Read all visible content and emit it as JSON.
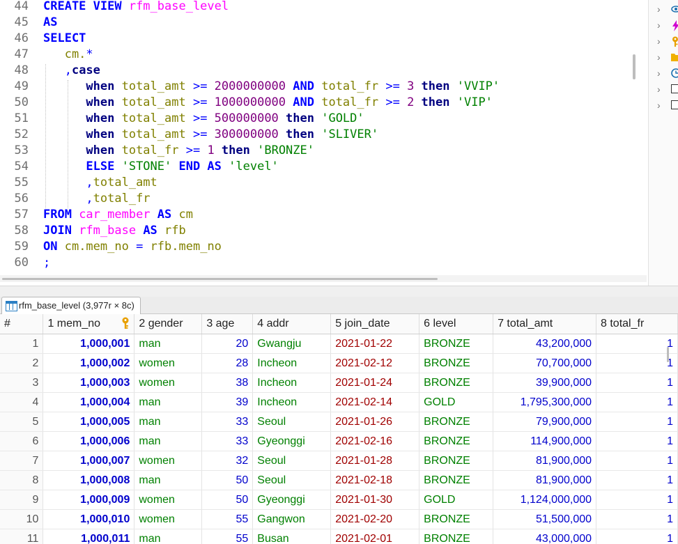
{
  "editor": {
    "line_numbers": [
      "44",
      "45",
      "46",
      "47",
      "48",
      "49",
      "50",
      "51",
      "52",
      "53",
      "54",
      "55",
      "56",
      "57",
      "58",
      "59",
      "60"
    ],
    "lines": [
      [
        {
          "t": "CREATE VIEW ",
          "c": "kw"
        },
        {
          "t": "rfm_base_level",
          "c": "tbl"
        }
      ],
      [
        {
          "t": "AS",
          "c": "kw"
        }
      ],
      [
        {
          "t": "SELECT",
          "c": "kw"
        }
      ],
      [
        {
          "t": "   cm.",
          "c": "id"
        },
        {
          "t": "*",
          "c": "op"
        }
      ],
      [
        {
          "t": "   ,",
          "c": "op"
        },
        {
          "t": "case",
          "c": "kwd"
        }
      ],
      [
        {
          "t": "      when ",
          "c": "kwd"
        },
        {
          "t": "total_amt",
          "c": "id"
        },
        {
          "t": " >= ",
          "c": "op"
        },
        {
          "t": "2000000000",
          "c": "num"
        },
        {
          "t": " AND ",
          "c": "kw"
        },
        {
          "t": "total_fr",
          "c": "id"
        },
        {
          "t": " >= ",
          "c": "op"
        },
        {
          "t": "3",
          "c": "num"
        },
        {
          "t": " then ",
          "c": "kwd"
        },
        {
          "t": "'VVIP'",
          "c": "str"
        }
      ],
      [
        {
          "t": "      when ",
          "c": "kwd"
        },
        {
          "t": "total_amt",
          "c": "id"
        },
        {
          "t": " >= ",
          "c": "op"
        },
        {
          "t": "1000000000",
          "c": "num"
        },
        {
          "t": " AND ",
          "c": "kw"
        },
        {
          "t": "total_fr",
          "c": "id"
        },
        {
          "t": " >= ",
          "c": "op"
        },
        {
          "t": "2",
          "c": "num"
        },
        {
          "t": " then ",
          "c": "kwd"
        },
        {
          "t": "'VIP'",
          "c": "str"
        }
      ],
      [
        {
          "t": "      when ",
          "c": "kwd"
        },
        {
          "t": "total_amt",
          "c": "id"
        },
        {
          "t": " >= ",
          "c": "op"
        },
        {
          "t": "500000000",
          "c": "num"
        },
        {
          "t": " then ",
          "c": "kwd"
        },
        {
          "t": "'GOLD'",
          "c": "str"
        }
      ],
      [
        {
          "t": "      when ",
          "c": "kwd"
        },
        {
          "t": "total_amt",
          "c": "id"
        },
        {
          "t": " >= ",
          "c": "op"
        },
        {
          "t": "300000000",
          "c": "num"
        },
        {
          "t": " then ",
          "c": "kwd"
        },
        {
          "t": "'SLIVER'",
          "c": "str"
        }
      ],
      [
        {
          "t": "      when ",
          "c": "kwd"
        },
        {
          "t": "total_fr",
          "c": "id"
        },
        {
          "t": " >= ",
          "c": "op"
        },
        {
          "t": "1",
          "c": "num"
        },
        {
          "t": " then ",
          "c": "kwd"
        },
        {
          "t": "'BRONZE'",
          "c": "str"
        }
      ],
      [
        {
          "t": "      ELSE ",
          "c": "kw"
        },
        {
          "t": "'STONE'",
          "c": "str"
        },
        {
          "t": " END AS ",
          "c": "kw"
        },
        {
          "t": "'level'",
          "c": "str"
        }
      ],
      [
        {
          "t": "      ,",
          "c": "op"
        },
        {
          "t": "total_amt",
          "c": "id"
        }
      ],
      [
        {
          "t": "      ,",
          "c": "op"
        },
        {
          "t": "total_fr",
          "c": "id"
        }
      ],
      [
        {
          "t": "FROM ",
          "c": "kw"
        },
        {
          "t": "car_member",
          "c": "tbl"
        },
        {
          "t": " AS ",
          "c": "kw"
        },
        {
          "t": "cm",
          "c": "id"
        }
      ],
      [
        {
          "t": "JOIN ",
          "c": "kw"
        },
        {
          "t": "rfm_base",
          "c": "tbl"
        },
        {
          "t": " AS ",
          "c": "kw"
        },
        {
          "t": "rfb",
          "c": "id"
        }
      ],
      [
        {
          "t": "ON ",
          "c": "kw"
        },
        {
          "t": "cm.mem_no",
          "c": "id"
        },
        {
          "t": " = ",
          "c": "op"
        },
        {
          "t": "rfb.mem_no",
          "c": "id"
        }
      ],
      [
        {
          "t": ";",
          "c": "op"
        }
      ]
    ]
  },
  "right_panel": {
    "items": [
      {
        "icon": "eye-icon",
        "color": "#1a6fb0"
      },
      {
        "icon": "lightning-icon",
        "color": "#d000d0"
      },
      {
        "icon": "key-icon",
        "color": "#e8a000"
      },
      {
        "icon": "folder-icon",
        "color": "#f0b000"
      },
      {
        "icon": "clock-icon",
        "color": "#1a6fb0"
      },
      {
        "icon": "checkbox-icon",
        "color": "#333333"
      },
      {
        "icon": "checkbox-icon",
        "color": "#333333"
      }
    ]
  },
  "result_tab": {
    "label": "rfm_base_level (3,977r × 8c)"
  },
  "grid": {
    "row_header": "#",
    "columns": [
      "1 mem_no",
      "2 gender",
      "3 age",
      "4 addr",
      "5 join_date",
      "6 level",
      "7 total_amt",
      "8 total_fr"
    ],
    "rows": [
      {
        "n": "1",
        "mem_no": "1,000,001",
        "gender": "man",
        "age": "20",
        "addr": "Gwangju",
        "join_date": "2021-01-22",
        "level": "BRONZE",
        "total_amt": "43,200,000",
        "total_fr": "1"
      },
      {
        "n": "2",
        "mem_no": "1,000,002",
        "gender": "women",
        "age": "28",
        "addr": "Incheon",
        "join_date": "2021-02-12",
        "level": "BRONZE",
        "total_amt": "70,700,000",
        "total_fr": "1"
      },
      {
        "n": "3",
        "mem_no": "1,000,003",
        "gender": "women",
        "age": "38",
        "addr": "Incheon",
        "join_date": "2021-01-24",
        "level": "BRONZE",
        "total_amt": "39,900,000",
        "total_fr": "1"
      },
      {
        "n": "4",
        "mem_no": "1,000,004",
        "gender": "man",
        "age": "39",
        "addr": "Incheon",
        "join_date": "2021-02-14",
        "level": "GOLD",
        "total_amt": "1,795,300,000",
        "total_fr": "1"
      },
      {
        "n": "5",
        "mem_no": "1,000,005",
        "gender": "man",
        "age": "33",
        "addr": "Seoul",
        "join_date": "2021-01-26",
        "level": "BRONZE",
        "total_amt": "79,900,000",
        "total_fr": "1"
      },
      {
        "n": "6",
        "mem_no": "1,000,006",
        "gender": "man",
        "age": "33",
        "addr": "Gyeonggi",
        "join_date": "2021-02-16",
        "level": "BRONZE",
        "total_amt": "114,900,000",
        "total_fr": "1"
      },
      {
        "n": "7",
        "mem_no": "1,000,007",
        "gender": "women",
        "age": "32",
        "addr": "Seoul",
        "join_date": "2021-01-28",
        "level": "BRONZE",
        "total_amt": "81,900,000",
        "total_fr": "1"
      },
      {
        "n": "8",
        "mem_no": "1,000,008",
        "gender": "man",
        "age": "50",
        "addr": "Seoul",
        "join_date": "2021-02-18",
        "level": "BRONZE",
        "total_amt": "81,900,000",
        "total_fr": "1"
      },
      {
        "n": "9",
        "mem_no": "1,000,009",
        "gender": "women",
        "age": "50",
        "addr": "Gyeonggi",
        "join_date": "2021-01-30",
        "level": "GOLD",
        "total_amt": "1,124,000,000",
        "total_fr": "1"
      },
      {
        "n": "10",
        "mem_no": "1,000,010",
        "gender": "women",
        "age": "55",
        "addr": "Gangwon",
        "join_date": "2021-02-20",
        "level": "BRONZE",
        "total_amt": "51,500,000",
        "total_fr": "1"
      },
      {
        "n": "11",
        "mem_no": "1,000,011",
        "gender": "man",
        "age": "55",
        "addr": "Busan",
        "join_date": "2021-02-01",
        "level": "BRONZE",
        "total_amt": "43,000,000",
        "total_fr": "1"
      }
    ]
  }
}
